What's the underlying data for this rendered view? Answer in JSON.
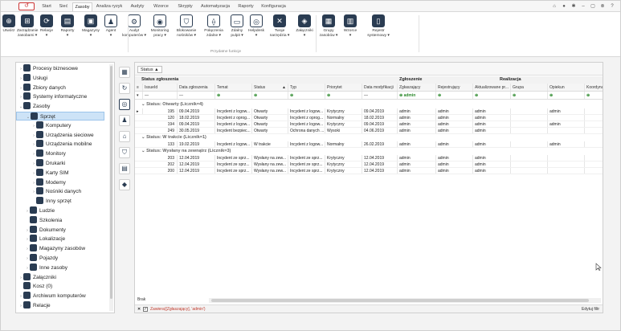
{
  "tabs": [
    "Start",
    "Sieć",
    "Zasoby",
    "Analiza ryzyk",
    "Audyty",
    "Wzorce",
    "Skrypty",
    "Automatyzacja",
    "Raporty",
    "Konfiguracja"
  ],
  "active_tab": "Zasoby",
  "ribbon": {
    "buttons": [
      {
        "label": "Utwórz",
        "icon": "create-icon"
      },
      {
        "label": "Zarządzanie\nzasobami ▾",
        "icon": "manage-assets-icon"
      },
      {
        "label": "Relacje\n▾",
        "icon": "relations-icon"
      },
      {
        "label": "Raporty\n▾",
        "icon": "reports-icon"
      },
      {
        "label": "Magazyny\n▾",
        "icon": "warehouse-icon"
      },
      {
        "label": "Agent\n▾",
        "icon": "agent-icon"
      },
      {
        "label": "Audyt\nkomputerów ▾",
        "icon": "audit-icon"
      },
      {
        "label": "Monitoring\npracy ▾",
        "icon": "monitoring-icon"
      },
      {
        "label": "Blokowanie\nnośników ▾",
        "icon": "shield-icon"
      },
      {
        "label": "Połączenia\nzdalne ▾",
        "icon": "remote-icon"
      },
      {
        "label": "Zdalny\npulpit ▾",
        "icon": "remote-desktop-icon"
      },
      {
        "label": "Helpdesk\n▾",
        "icon": "helpdesk-icon"
      },
      {
        "label": "Twoje\nnarzędzia ▾",
        "icon": "tools-icon"
      },
      {
        "label": "Załączniki\n▾",
        "icon": "attachments-icon"
      },
      {
        "label": "Grupy\nzasobów ▾",
        "icon": "groups-icon"
      },
      {
        "label": "Wzorce\n▾",
        "icon": "patterns-icon"
      },
      {
        "label": "Rejestr\nsystemowy ▾",
        "icon": "registry-icon"
      }
    ],
    "group_label": "Przydatne funkcje"
  },
  "tree": [
    {
      "label": "Procesy biznesowe",
      "level": 0,
      "arrow": "›",
      "icon": "process-icon"
    },
    {
      "label": "Usługi",
      "level": 0,
      "arrow": "›",
      "icon": "services-icon"
    },
    {
      "label": "Zbiory danych",
      "level": 0,
      "arrow": "›",
      "icon": "datasets-icon"
    },
    {
      "label": "Systemy informatyczne",
      "level": 0,
      "arrow": "›",
      "icon": "systems-icon"
    },
    {
      "label": "Zasoby",
      "level": 0,
      "arrow": "⌄",
      "icon": "assets-icon"
    },
    {
      "label": "Sprzęt",
      "level": 1,
      "arrow": "⌄",
      "icon": "hardware-icon",
      "selected": true
    },
    {
      "label": "Komputery",
      "level": 2,
      "arrow": "›",
      "icon": "computer-icon"
    },
    {
      "label": "Urządzenia sieciowe",
      "level": 2,
      "arrow": "›",
      "icon": "network-device-icon"
    },
    {
      "label": "Urządzenia mobilne",
      "level": 2,
      "arrow": "›",
      "icon": "mobile-icon"
    },
    {
      "label": "Monitory",
      "level": 2,
      "arrow": "›",
      "icon": "monitor-icon"
    },
    {
      "label": "Drukarki",
      "level": 2,
      "arrow": "›",
      "icon": "printer-icon"
    },
    {
      "label": "Karty SIM",
      "level": 2,
      "arrow": "›",
      "icon": "sim-icon"
    },
    {
      "label": "Modemy",
      "level": 2,
      "arrow": "›",
      "icon": "modem-icon"
    },
    {
      "label": "Nośniki danych",
      "level": 2,
      "arrow": "›",
      "icon": "storage-icon"
    },
    {
      "label": "Inny sprzęt",
      "level": 2,
      "arrow": "",
      "icon": "other-hardware-icon"
    },
    {
      "label": "Ludzie",
      "level": 1,
      "arrow": "›",
      "icon": "people-icon"
    },
    {
      "label": "Szkolenia",
      "level": 1,
      "arrow": "",
      "icon": "training-icon"
    },
    {
      "label": "Dokumenty",
      "level": 1,
      "arrow": "›",
      "icon": "documents-icon"
    },
    {
      "label": "Lokalizacje",
      "level": 1,
      "arrow": "›",
      "icon": "locations-icon"
    },
    {
      "label": "Magazyny zasobów",
      "level": 1,
      "arrow": "›",
      "icon": "warehouse-icon"
    },
    {
      "label": "Pojazdy",
      "level": 1,
      "arrow": "›",
      "icon": "vehicles-icon"
    },
    {
      "label": "Inne zasoby",
      "level": 1,
      "arrow": "›",
      "icon": "other-assets-icon"
    },
    {
      "label": "Załączniki",
      "level": 0,
      "arrow": "›",
      "icon": "attachments-icon"
    },
    {
      "label": "Kosz (0)",
      "level": 0,
      "arrow": "",
      "icon": "trash-icon"
    },
    {
      "label": "Archiwum komputerów",
      "level": 0,
      "arrow": "›",
      "icon": "archive-icon"
    },
    {
      "label": "Relacje",
      "level": 0,
      "arrow": "›",
      "icon": "relations-icon"
    }
  ],
  "grid": {
    "group_chip": "Status ▲",
    "bands": [
      {
        "label": "Status zgłoszenia"
      },
      {
        "label": "Zgłoszenie"
      },
      {
        "label": "Realizacja"
      }
    ],
    "columns": [
      "IssueId",
      "Data zgłoszenia",
      "Temat",
      "Status",
      "Typ",
      "Priorytet",
      "Data modyfikacji",
      "Zgłaszający",
      "Rejestrujący",
      "Aktualizowane pr...",
      "Grupa",
      "Opiekun",
      "Koordyna"
    ],
    "sort_indicator": "▲",
    "filter_row": [
      "—",
      "—",
      "⊕",
      "⊕",
      "⊕",
      "⊕",
      "—",
      "⊕ admin",
      "⊕",
      "⊕",
      "⊕",
      "⊕",
      "⊕"
    ],
    "groups": [
      {
        "title": "Status: Otwarty (Licznik=4)",
        "rows": [
          [
            "195",
            "09.04.2019",
            "Incydent z logow...",
            "Otwarty",
            "Incydent z logow...",
            "Krytyczny",
            "09.04.2019",
            "admin",
            "admin",
            "admin",
            "",
            "admin",
            ""
          ],
          [
            "120",
            "18.02.2019",
            "Incydent z oprog...",
            "Otwarty",
            "Incydent z oprog...",
            "Normalny",
            "18.02.2019",
            "admin",
            "admin",
            "admin",
            "",
            "",
            ""
          ],
          [
            "194",
            "09.04.2019",
            "Incydent z logow...",
            "Otwarty",
            "Incydent z logow...",
            "Krytyczny",
            "09.04.2019",
            "admin",
            "admin",
            "admin",
            "",
            "admin",
            ""
          ],
          [
            "249",
            "30.05.2019",
            "Incydent bezpiec...",
            "Otwarty",
            "Ochrona danych ...",
            "Wysoki",
            "04.06.2019",
            "admin",
            "admin",
            "admin",
            "",
            "",
            ""
          ]
        ]
      },
      {
        "title": "Status: W trakcie (Licznik=1)",
        "rows": [
          [
            "133",
            "19.02.2019",
            "Incydent z logow...",
            "W trakcie",
            "Incydent z logow...",
            "Normalny",
            "26.02.2019",
            "admin",
            "admin",
            "admin",
            "",
            "admin",
            ""
          ]
        ]
      },
      {
        "title": "Status: Wysłany na zewnątrz (Licznik=3)",
        "rows": [
          [
            "203",
            "12.04.2019",
            "Incydent ze sprz...",
            "Wysłany na zew...",
            "Incydent ze sprz...",
            "Krytyczny",
            "12.04.2019",
            "admin",
            "admin",
            "admin",
            "",
            "",
            ""
          ],
          [
            "202",
            "12.04.2019",
            "Incydent ze sprz...",
            "Wysłany na zew...",
            "Incydent ze sprz...",
            "Krytyczny",
            "12.04.2019",
            "admin",
            "admin",
            "admin",
            "",
            "",
            ""
          ],
          [
            "200",
            "12.04.2019",
            "Incydent ze sprz...",
            "Wysłany na zew...",
            "Incydent ze sprz...",
            "Krytyczny",
            "12.04.2019",
            "admin",
            "admin",
            "admin",
            "",
            "",
            ""
          ]
        ]
      }
    ],
    "bottom_left": "Brak",
    "filter_expression": "Zawiera([Zgłaszający], 'admin')",
    "edit_filter": "Edytuj filtr"
  },
  "colors": {
    "accent": "#2a3c52",
    "selected": "#cde3f7",
    "filter_text": "#c0392b",
    "filter_icon": "#2d8a2d"
  }
}
